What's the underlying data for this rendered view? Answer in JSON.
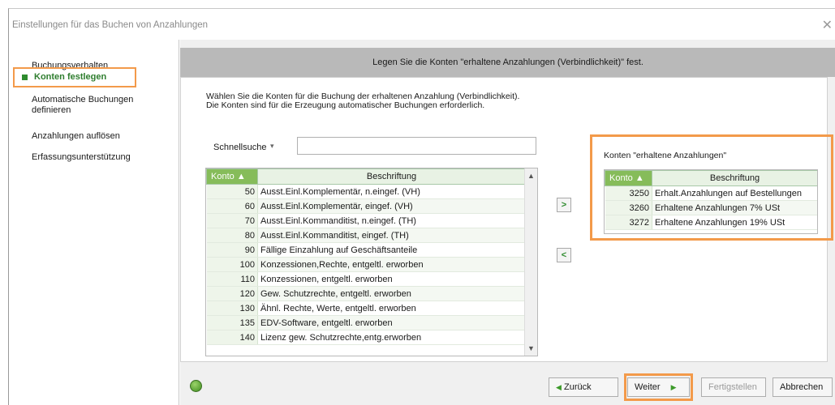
{
  "window": {
    "title": "Einstellungen für das Buchen von Anzahlungen",
    "close_symbol": "✕"
  },
  "sidebar": {
    "items": [
      {
        "label": "Buchungsverhalten"
      },
      {
        "label": "Konten festlegen"
      },
      {
        "label": "Automatische Buchungen definieren"
      },
      {
        "label": "Anzahlungen auflösen"
      },
      {
        "label": "Erfassungsunterstützung"
      }
    ]
  },
  "banner": {
    "text": "Legen Sie die Konten \"erhaltene Anzahlungen (Verbindlichkeit)\" fest."
  },
  "description": {
    "line1": "Wählen Sie die Konten für die Buchung der erhaltenen Anzahlung (Verbindlichkeit).",
    "line2": "Die Konten sind für die Erzeugung automatischer Buchungen erforderlich."
  },
  "search": {
    "label": "Schnellsuche",
    "value": ""
  },
  "left_table": {
    "col_konto": "Konto",
    "col_beschriftung": "Beschriftung",
    "rows": [
      {
        "konto": "50",
        "beschriftung": "Ausst.Einl.Komplementär, n.eingef. (VH)"
      },
      {
        "konto": "60",
        "beschriftung": "Ausst.Einl.Komplementär, eingef. (VH)"
      },
      {
        "konto": "70",
        "beschriftung": "Ausst.Einl.Kommanditist, n.eingef. (TH)"
      },
      {
        "konto": "80",
        "beschriftung": "Ausst.Einl.Kommanditist, eingef. (TH)"
      },
      {
        "konto": "90",
        "beschriftung": "Fällige Einzahlung auf Geschäftsanteile"
      },
      {
        "konto": "100",
        "beschriftung": "Konzessionen,Rechte, entgeltl. erworben"
      },
      {
        "konto": "110",
        "beschriftung": "Konzessionen, entgeltl. erworben"
      },
      {
        "konto": "120",
        "beschriftung": "Gew. Schutzrechte, entgeltl. erworben"
      },
      {
        "konto": "130",
        "beschriftung": "Ähnl. Rechte, Werte, entgeltl. erworben"
      },
      {
        "konto": "135",
        "beschriftung": "EDV-Software, entgeltl. erworben"
      },
      {
        "konto": "140",
        "beschriftung": "Lizenz gew. Schutzrechte,entg.erworben"
      }
    ]
  },
  "right_panel": {
    "label": "Konten \"erhaltene Anzahlungen\"",
    "col_konto": "Konto",
    "col_beschriftung": "Beschriftung",
    "rows": [
      {
        "konto": "3250",
        "beschriftung": "Erhalt.Anzahlungen auf Bestellungen"
      },
      {
        "konto": "3260",
        "beschriftung": "Erhaltene Anzahlungen 7% USt"
      },
      {
        "konto": "3272",
        "beschriftung": "Erhaltene Anzahlungen 19% USt"
      }
    ]
  },
  "footer": {
    "back_label": "Zurück",
    "next_label": "Weiter",
    "finish_label": "Fertigstellen",
    "cancel_label": "Abbrechen"
  }
}
